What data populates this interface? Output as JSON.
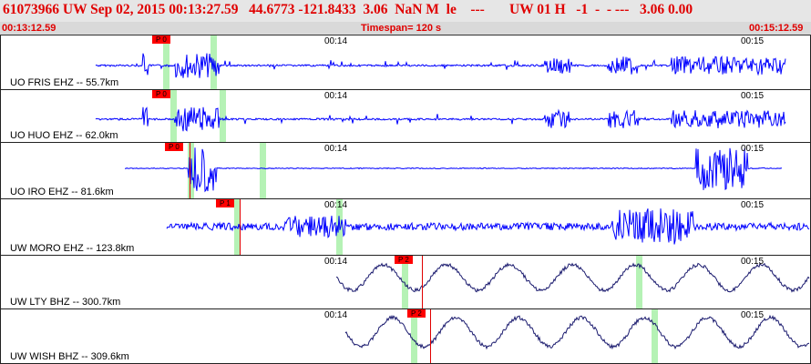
{
  "header": {
    "title": "61073966 UW Sep 02, 2015 00:13:27.59   44.6773 -121.8433  3.06  NaN M  le    ---       UW 01 H   -1  -  - ---   3.06 0.00",
    "start_time": "00:13:12.59",
    "timespan": "Timespan= 120 s",
    "end_time": "00:15:12.59"
  },
  "channels": [
    {
      "label": "UO FRIS EHZ -- 55.7km",
      "pick": "P 0",
      "tick1": "00:14",
      "tick2": "00:15"
    },
    {
      "label": "UO HUO EHZ -- 62.0km",
      "pick": "P 0",
      "tick1": "00:14",
      "tick2": "00:15"
    },
    {
      "label": "UO IRO EHZ -- 81.6km",
      "pick": "P 0",
      "tick1": "00:14",
      "tick2": "00:15"
    },
    {
      "label": "UW MORO EHZ -- 123.8km",
      "pick": "P 1",
      "tick1": "00:14",
      "tick2": "00:15"
    },
    {
      "label": "UW LTY BHZ -- 300.7km",
      "pick": "P 2",
      "tick1": "00:14",
      "tick2": "00:15"
    },
    {
      "label": "UW WISH BHZ -- 309.6km",
      "pick": "P 2",
      "tick1": "00:14",
      "tick2": "00:15"
    }
  ],
  "colors": {
    "trace_short": "#0000ff",
    "trace_long": "#1a1a6e",
    "pick": "#ff0000",
    "window": "#a8f0a8",
    "title": "#e00000"
  }
}
